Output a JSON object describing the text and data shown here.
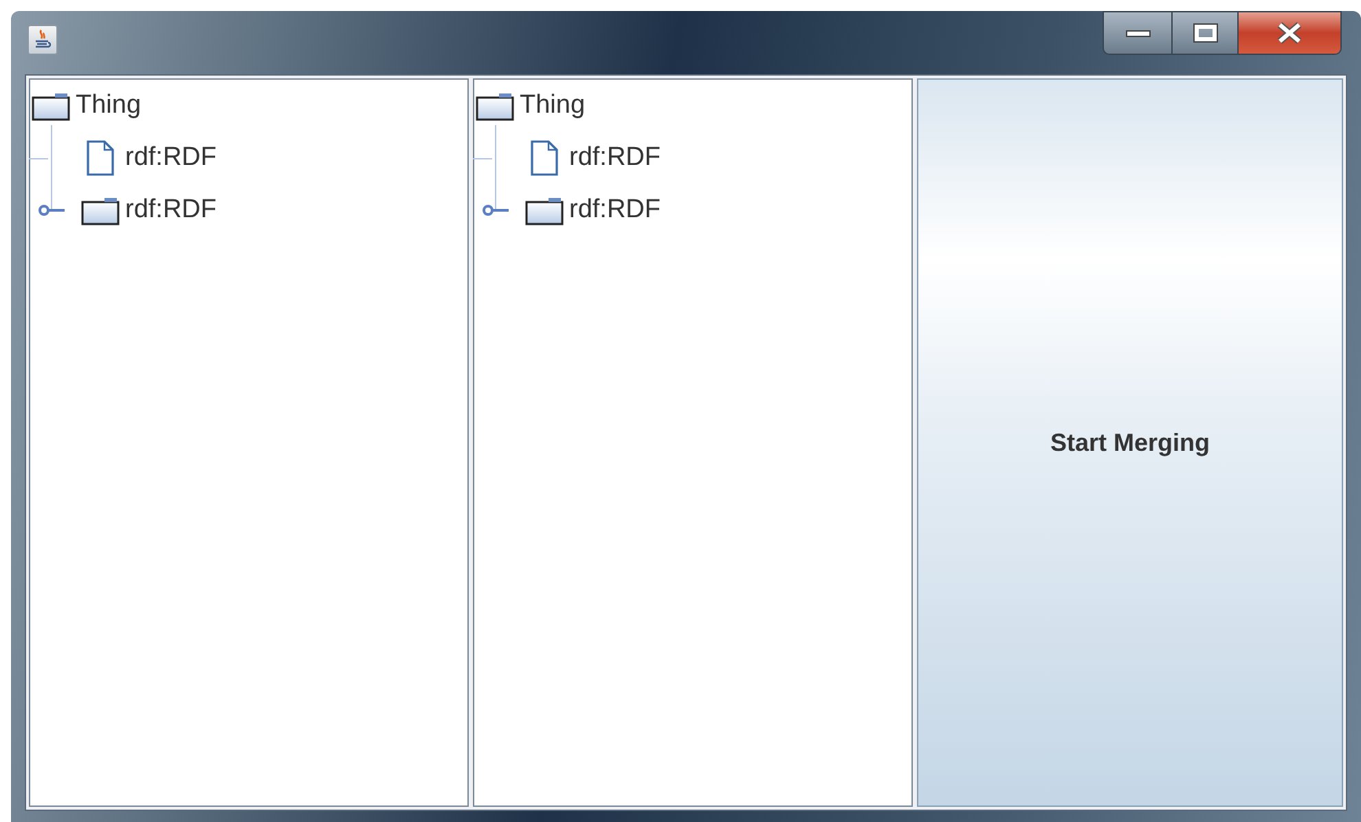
{
  "trees": [
    {
      "root": {
        "label": "Thing",
        "kind": "folder",
        "expanded": true,
        "children": [
          {
            "label": "rdf:RDF",
            "kind": "leaf"
          },
          {
            "label": "rdf:RDF",
            "kind": "folder",
            "expanded": false
          }
        ]
      }
    },
    {
      "root": {
        "label": "Thing",
        "kind": "folder",
        "expanded": true,
        "children": [
          {
            "label": "rdf:RDF",
            "kind": "leaf"
          },
          {
            "label": "rdf:RDF",
            "kind": "folder",
            "expanded": false
          }
        ]
      }
    }
  ],
  "merge_button": {
    "label": "Start Merging"
  }
}
